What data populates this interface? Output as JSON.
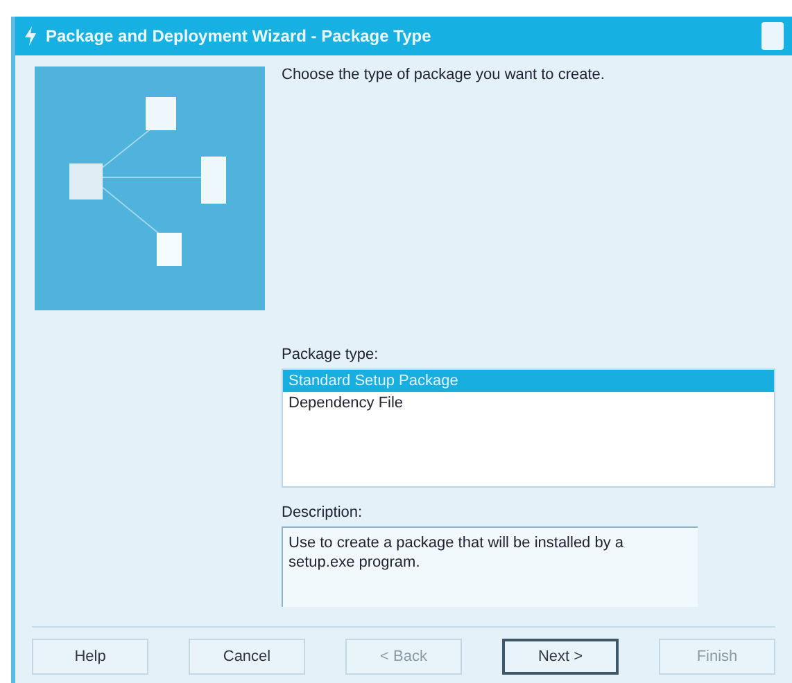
{
  "window": {
    "title": "Package and Deployment Wizard - Package Type"
  },
  "prompt": "Choose the type of package you want to create.",
  "package_type": {
    "label": "Package type:",
    "items": [
      {
        "label": "Standard Setup Package",
        "selected": true
      },
      {
        "label": "Dependency File",
        "selected": false
      }
    ]
  },
  "description": {
    "label": "Description:",
    "text": "Use to create a package that will be installed by a setup.exe program."
  },
  "buttons": [
    {
      "label": "Help",
      "disabled": false,
      "default": false
    },
    {
      "label": "Cancel",
      "disabled": false,
      "default": false
    },
    {
      "label": "< Back",
      "disabled": true,
      "default": false
    },
    {
      "label": "Next >",
      "disabled": false,
      "default": true
    },
    {
      "label": "Finish",
      "disabled": true,
      "default": false
    }
  ]
}
